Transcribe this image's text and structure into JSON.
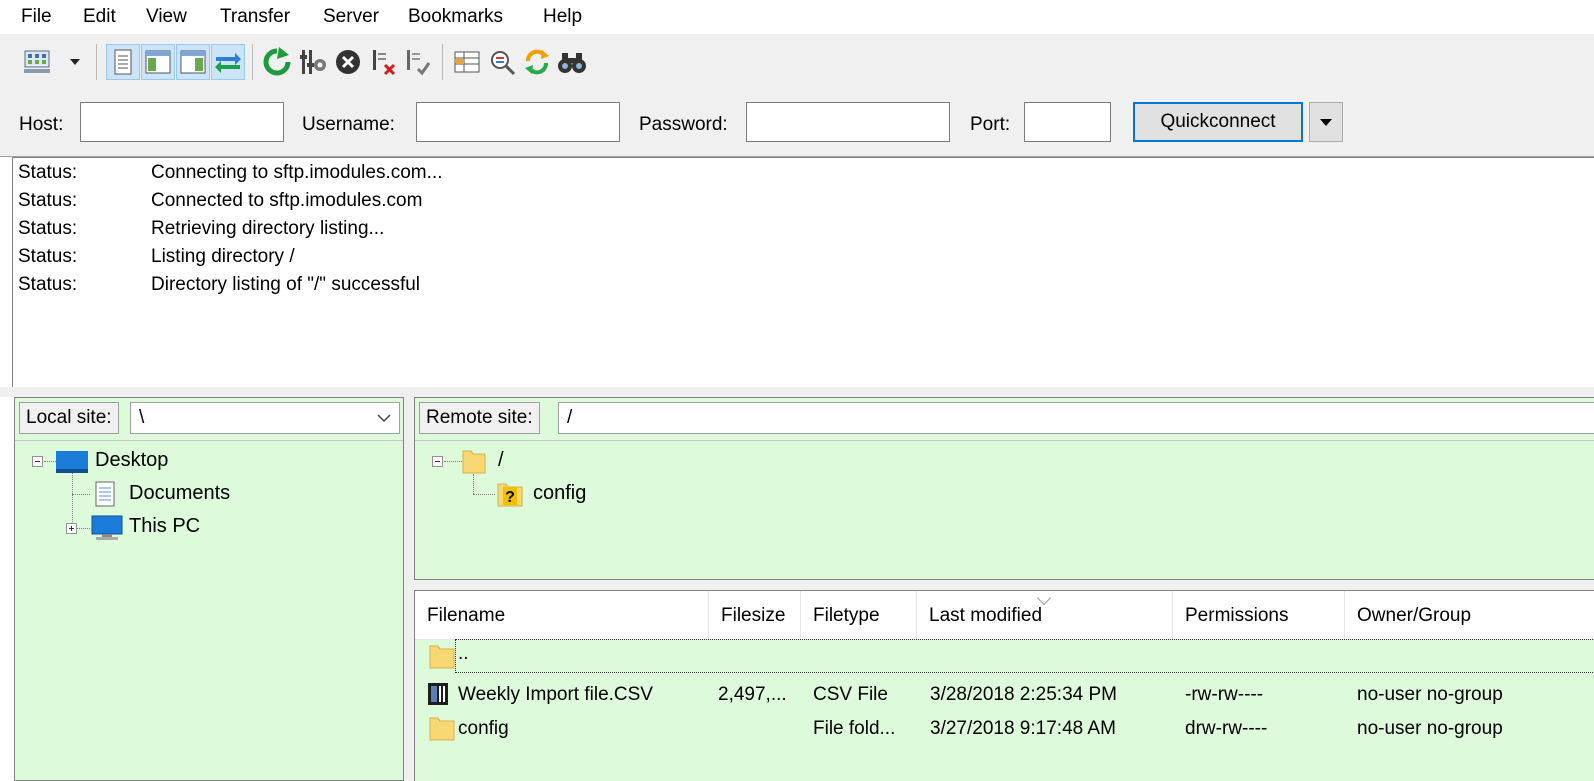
{
  "menu": [
    "File",
    "Edit",
    "View",
    "Transfer",
    "Server",
    "Bookmarks",
    "Help"
  ],
  "toolbar": {
    "icons": [
      "site-manager-icon",
      "site-manager-dropdown-icon",
      "toggle-message-log-icon",
      "toggle-local-tree-icon",
      "toggle-remote-tree-icon",
      "toggle-transfer-queue-icon",
      "refresh-icon",
      "process-queue-icon",
      "cancel-icon",
      "disconnect-icon",
      "reconnect-icon",
      "directory-filter-icon",
      "directory-compare-icon",
      "sync-browsing-icon",
      "search-icon"
    ]
  },
  "quickconnect": {
    "host_label": "Host:",
    "username_label": "Username:",
    "password_label": "Password:",
    "port_label": "Port:",
    "host_value": "",
    "username_value": "",
    "password_value": "",
    "port_value": "",
    "button_label": "Quickconnect"
  },
  "log": [
    {
      "label": "Status:",
      "message": "Connecting to sftp.imodules.com..."
    },
    {
      "label": "Status:",
      "message": "Connected to sftp.imodules.com"
    },
    {
      "label": "Status:",
      "message": "Retrieving directory listing..."
    },
    {
      "label": "Status:",
      "message": "Listing directory /"
    },
    {
      "label": "Status:",
      "message": "Directory listing of \"/\" successful"
    }
  ],
  "local": {
    "label": "Local site:",
    "path": "\\",
    "tree": [
      {
        "name": "Desktop",
        "icon": "desktop-icon"
      },
      {
        "name": "Documents",
        "icon": "documents-icon"
      },
      {
        "name": "This PC",
        "icon": "computer-icon"
      }
    ]
  },
  "remote": {
    "label": "Remote site:",
    "path": "/",
    "tree": [
      {
        "name": "/",
        "icon": "folder-icon"
      },
      {
        "name": "config",
        "icon": "unknown-folder-icon"
      }
    ]
  },
  "filelist": {
    "columns": [
      "Filename",
      "Filesize",
      "Filetype",
      "Last modified",
      "Permissions",
      "Owner/Group"
    ],
    "rows": [
      {
        "icon": "folder-icon",
        "name": "..",
        "size": "",
        "type": "",
        "modified": "",
        "perms": "",
        "owner": ""
      },
      {
        "icon": "csv-file-icon",
        "name": "Weekly Import file.CSV",
        "size": "2,497,...",
        "type": "CSV File",
        "modified": "3/28/2018 2:25:34 PM",
        "perms": "-rw-rw----",
        "owner": "no-user no-group"
      },
      {
        "icon": "folder-icon",
        "name": "config",
        "size": "",
        "type": "File fold...",
        "modified": "3/27/2018 9:17:48 AM",
        "perms": "drw-rw----",
        "owner": "no-user no-group"
      }
    ]
  },
  "colors": {
    "pane_bg": "#ddfada",
    "accent": "#0078d7",
    "folder": "#f8d775"
  }
}
